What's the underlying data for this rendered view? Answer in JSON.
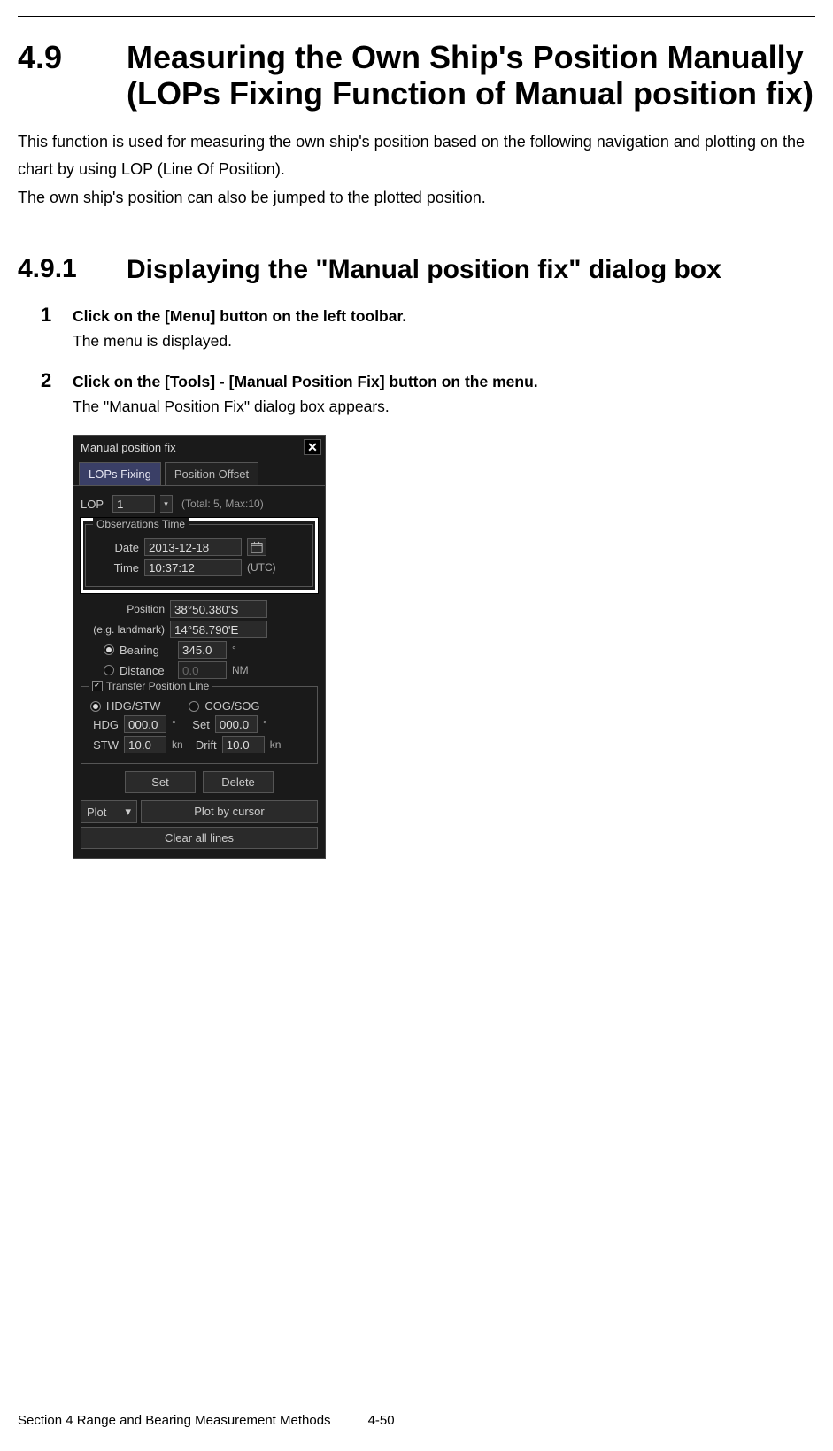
{
  "section": {
    "number": "4.9",
    "title": "Measuring the Own Ship's Position Manually (LOPs Fixing Function of Manual position fix)",
    "intro1": "This function is used for measuring the own ship's position based on the following navigation and plotting on the chart by using LOP (Line Of Position).",
    "intro2": "The own ship's position can also be jumped to the plotted position."
  },
  "subsection": {
    "number": "4.9.1",
    "title": "Displaying the \"Manual position fix\" dialog box"
  },
  "steps": [
    {
      "num": "1",
      "bold": "Click on the [Menu] button on the left toolbar.",
      "text": "The menu is displayed."
    },
    {
      "num": "2",
      "bold": "Click on the [Tools] - [Manual Position Fix] button on the menu.",
      "text": "The \"Manual Position Fix\" dialog box appears."
    }
  ],
  "dialog": {
    "title": "Manual position fix",
    "close_glyph": "✕",
    "tabs": {
      "active": "LOPs Fixing",
      "other": "Position Offset"
    },
    "lop": {
      "label": "LOP",
      "value": "1",
      "total": "(Total:  5, Max:10)"
    },
    "obs": {
      "legend": "Observations Time",
      "date_label": "Date",
      "date_value": "2013-12-18",
      "time_label": "Time",
      "time_value": "10:37:12",
      "time_unit": "(UTC)"
    },
    "pos": {
      "label1": "Position",
      "lat": "38°50.380'S",
      "label2": "(e.g. landmark)",
      "lon": "14°58.790'E"
    },
    "bearing": {
      "label": "Bearing",
      "value": "345.0",
      "unit": "°"
    },
    "distance": {
      "label": "Distance",
      "value": "0.0",
      "unit": "NM"
    },
    "tpl": {
      "legend": "Transfer Position Line",
      "opt1": "HDG/STW",
      "opt2": "COG/SOG",
      "hdg_label": "HDG",
      "hdg_value": "000.0",
      "hdg_unit": "°",
      "set_label": "Set",
      "set_value": "000.0",
      "set_unit": "°",
      "stw_label": "STW",
      "stw_value": "10.0",
      "stw_unit": "kn",
      "drift_label": "Drift",
      "drift_value": "10.0",
      "drift_unit": "kn"
    },
    "buttons": {
      "set": "Set",
      "delete": "Delete",
      "plot": "Plot",
      "plot_cursor": "Plot by cursor",
      "clear": "Clear all lines"
    }
  },
  "footer": {
    "section": "Section 4    Range and Bearing Measurement Methods",
    "page": "4-50"
  }
}
